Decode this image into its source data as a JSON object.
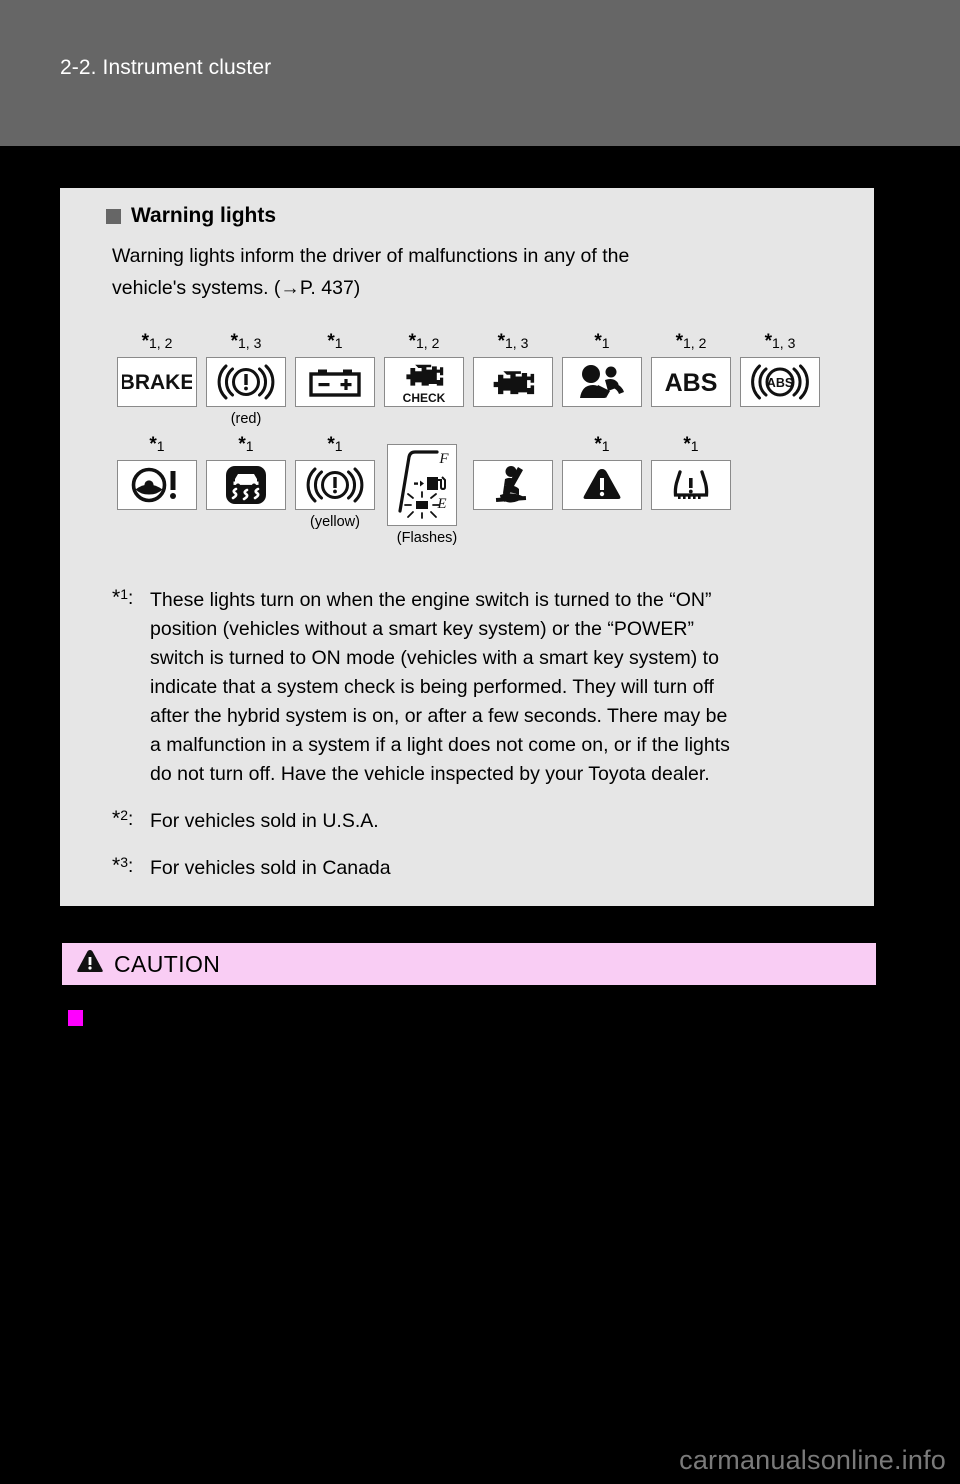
{
  "header": {
    "title": "2-2. Instrument cluster"
  },
  "section": {
    "bullet_icon": "square-bullet",
    "heading": "Warning lights",
    "intro_line1": "Warning lights inform the driver of malfunctions in any of the",
    "intro_line2": "vehicle's systems. (→P. 437)"
  },
  "warning_lights": {
    "row1": [
      {
        "icon": "brake-warning-light",
        "star": "*1, 2",
        "star_main": "*",
        "star_sub": "1, 2",
        "sublabel": ""
      },
      {
        "icon": "brake-system-circle-warning-light",
        "star": "*1, 3",
        "star_main": "*",
        "star_sub": "1, 3",
        "sublabel": "(red)"
      },
      {
        "icon": "charging-system-battery-warning-light",
        "star": "*1",
        "star_main": "*",
        "star_sub": "1",
        "sublabel": ""
      },
      {
        "icon": "check-engine-warning-light",
        "star": "*1, 2",
        "star_main": "*",
        "star_sub": "1, 2",
        "sublabel": ""
      },
      {
        "icon": "engine-malfunction-warning-light",
        "star": "*1, 3",
        "star_main": "*",
        "star_sub": "1, 3",
        "sublabel": ""
      },
      {
        "icon": "srs-airbag-warning-light",
        "star": "*1",
        "star_main": "*",
        "star_sub": "1",
        "sublabel": ""
      },
      {
        "icon": "abs-warning-light",
        "star": "*1, 2",
        "star_main": "*",
        "star_sub": "1, 2",
        "sublabel": ""
      },
      {
        "icon": "abs-circle-warning-light",
        "star": "*1, 3",
        "star_main": "*",
        "star_sub": "1, 3",
        "sublabel": ""
      }
    ],
    "row2": [
      {
        "icon": "electric-power-steering-warning-light",
        "star": "*1",
        "star_main": "*",
        "star_sub": "1",
        "sublabel": ""
      },
      {
        "icon": "slip-indicator-warning-light",
        "star": "*1",
        "star_main": "*",
        "star_sub": "1",
        "sublabel": ""
      },
      {
        "icon": "brake-system-circle-yellow-warning-light",
        "star": "*1",
        "star_main": "*",
        "star_sub": "1",
        "sublabel": "(yellow)"
      },
      {
        "icon": "low-fuel-level-warning-light",
        "star": "",
        "star_main": "",
        "star_sub": "",
        "sublabel": "(Flashes)",
        "gauge_full": "F",
        "gauge_empty": "E"
      },
      {
        "icon": "seat-belt-reminder-light",
        "star": "",
        "star_main": "",
        "star_sub": "",
        "sublabel": ""
      },
      {
        "icon": "master-warning-light",
        "star": "*1",
        "star_main": "*",
        "star_sub": "1",
        "sublabel": ""
      },
      {
        "icon": "tire-pressure-warning-light",
        "star": "*1",
        "star_main": "*",
        "star_sub": "1",
        "sublabel": ""
      }
    ]
  },
  "footnotes": [
    {
      "mark_main": "*",
      "mark_sup": "1",
      "mark_colon": ":",
      "lines": [
        "These lights turn on when the engine switch is turned to the “ON”",
        "position (vehicles without a smart key system) or the “POWER”",
        "switch is turned to ON mode (vehicles with a smart key system) to",
        "indicate that a system check is being performed. They will turn off",
        "after the hybrid system is on, or after a few seconds. There may be",
        "a malfunction in a system if a light does not come on, or if the lights",
        "do not turn off. Have the vehicle inspected by your Toyota dealer."
      ]
    },
    {
      "mark_main": "*",
      "mark_sup": "2",
      "mark_colon": ":",
      "lines": [
        "For vehicles sold in U.S.A."
      ]
    },
    {
      "mark_main": "*",
      "mark_sup": "3",
      "mark_colon": ":",
      "lines": [
        "For vehicles sold in Canada"
      ]
    }
  ],
  "caution": {
    "icon": "warning-triangle-icon",
    "label": "CAUTION",
    "bullet_icon": "magenta-square-bullet",
    "background_color": "#f9cdf4"
  },
  "watermark": {
    "text": "carmanualsonline.info"
  },
  "colors": {
    "header_band": "#666666",
    "page_background": "#000000",
    "content_panel": "#e6e6e6",
    "caution_band": "#f9cdf4",
    "caution_bullet": "#ff00ff"
  }
}
